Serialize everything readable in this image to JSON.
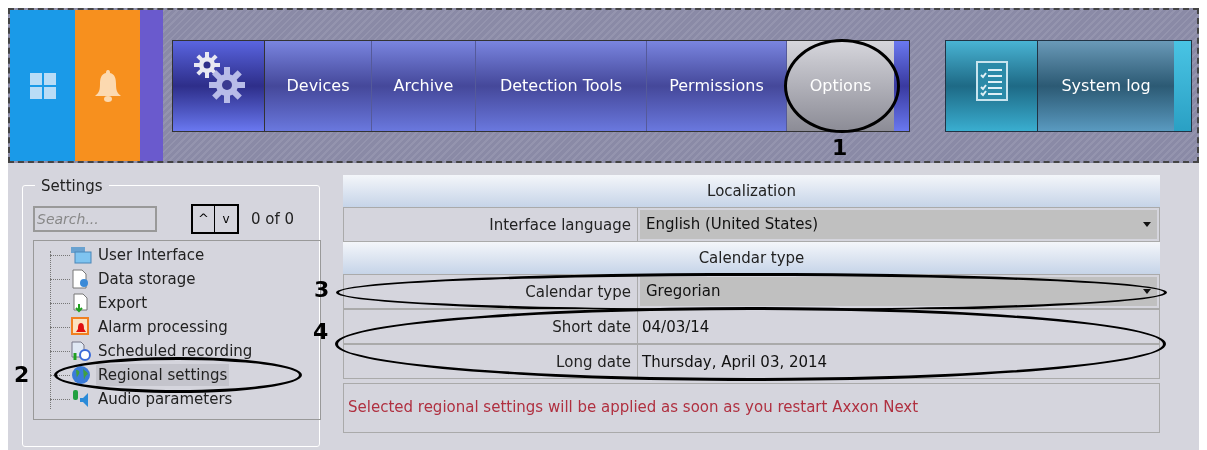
{
  "top_bar": {
    "tiles": [
      {
        "kind": "windows"
      },
      {
        "kind": "bell"
      }
    ],
    "nav_tabs": [
      {
        "label": "Devices",
        "selected": false
      },
      {
        "label": "Archive",
        "selected": false
      },
      {
        "label": "Detection Tools",
        "selected": false
      },
      {
        "label": "Permissions",
        "selected": false
      },
      {
        "label": "Options",
        "selected": true,
        "callout": "1"
      }
    ],
    "system_log": {
      "label": "System log"
    }
  },
  "settings": {
    "title": "Settings",
    "search": {
      "placeholder": "Search..."
    },
    "up": "^",
    "down": "v",
    "match_count": "0 of 0",
    "tree": [
      {
        "label": "User Interface",
        "kind": "window",
        "selected": false
      },
      {
        "label": "Data storage",
        "kind": "storage",
        "selected": false
      },
      {
        "label": "Export",
        "kind": "export",
        "selected": false
      },
      {
        "label": "Alarm processing",
        "kind": "alarm",
        "selected": false
      },
      {
        "label": "Scheduled recording",
        "kind": "schedule",
        "selected": false
      },
      {
        "label": "Regional settings",
        "kind": "globe",
        "selected": true,
        "callout": "2"
      },
      {
        "label": "Audio parameters",
        "kind": "audio",
        "selected": false
      }
    ]
  },
  "regional": {
    "sections": [
      {
        "title": "Localization",
        "rows": [
          {
            "label": "Interface language",
            "value": "English (United States)",
            "kind": "dropdown"
          }
        ]
      },
      {
        "title": "Calendar type",
        "rows": [
          {
            "label": "Calendar type",
            "value": "Gregorian",
            "kind": "dropdown",
            "callout": "3"
          }
        ]
      }
    ],
    "date_rows": {
      "callout": "4",
      "rows": [
        {
          "label": "Short date",
          "value": "04/03/14"
        },
        {
          "label": "Long date",
          "value": "Thursday, April 03, 2014"
        }
      ]
    },
    "notice": "Selected regional settings will be applied as soon as you restart Axxon Next"
  }
}
